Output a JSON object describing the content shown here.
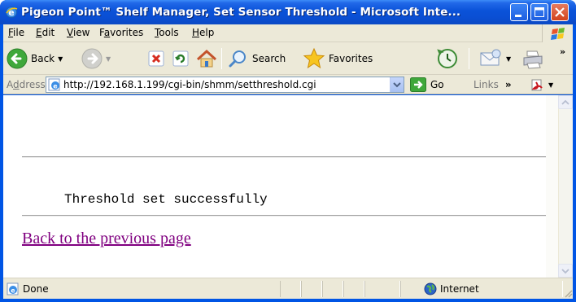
{
  "window": {
    "title": "Pigeon Point™ Shelf Manager, Set Sensor Threshold - Microsoft Inte..."
  },
  "menu": {
    "items": [
      {
        "underline": "F",
        "rest": "ile"
      },
      {
        "underline": "E",
        "rest": "dit"
      },
      {
        "underline": "V",
        "rest": "iew"
      },
      {
        "pre": "F",
        "underline": "a",
        "rest": "vorites"
      },
      {
        "underline": "T",
        "rest": "ools"
      },
      {
        "underline": "H",
        "rest": "elp"
      }
    ]
  },
  "toolbar": {
    "back_label": "Back",
    "search_label": "Search",
    "favorites_label": "Favorites"
  },
  "address": {
    "label_pre": "A",
    "label_underline": "d",
    "label_rest": "dress",
    "url": "http://192.168.1.199/cgi-bin/shmm/setthreshold.cgi",
    "go_label": "Go",
    "links_label": "Links"
  },
  "page": {
    "result_text": "Threshold set successfully",
    "back_link": "Back to the previous page"
  },
  "status": {
    "text": "Done",
    "zone": "Internet"
  },
  "colors": {
    "titlebar": "#0a52d8",
    "chrome": "#ece9d8",
    "visited_link": "#800080"
  }
}
